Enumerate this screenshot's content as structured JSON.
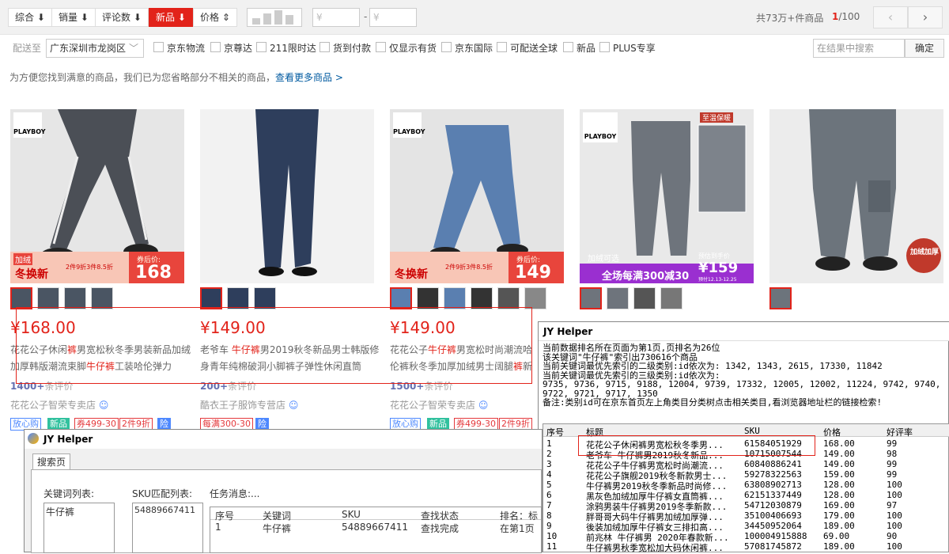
{
  "sortbar": {
    "items": [
      "综合",
      "销量",
      "评论数",
      "新品",
      "价格"
    ],
    "price_min_placeholder": "¥",
    "price_max_placeholder": "¥",
    "price_dash": "-",
    "total": "共73万+件商品",
    "page_current": "1",
    "page_total": "/100",
    "prev": "‹",
    "next": "›"
  },
  "filters": {
    "deliver_label": "配送至",
    "location": "广东深圳市龙岗区",
    "options": [
      "京东物流",
      "京尊达",
      "211限时达",
      "货到付款",
      "仅显示有货",
      "京东国际",
      "可配送全球",
      "新品",
      "PLUS专享"
    ],
    "search_placeholder": "在结果中搜索",
    "confirm": "确定"
  },
  "notice": {
    "text": "为方便您找到满意的商品，我们已为您省略部分不相关的商品，",
    "link": "查看更多商品 >"
  },
  "products": [
    {
      "price": "¥168.00",
      "title_a": "花花公子休闲",
      "title_b": "裤",
      "title_c": "男宽松秋冬季男装新品加绒加厚韩版潮流束脚",
      "title_d": "牛仔裤",
      "title_e": "工装哈伦弹力",
      "comments": "1400+",
      "comments_suffix": "条评价",
      "shop": "花花公子智荣专卖店",
      "badges": [
        "放心购",
        "新品",
        "券499-30",
        "2件9折",
        "险"
      ],
      "promo": "2件9折3件8.5折",
      "promo2": "券后价:",
      "promo_price": "168",
      "promo_tag": "冬换新",
      "brand": "PLAYBOY",
      "corner": "加绒"
    },
    {
      "price": "¥149.00",
      "title_a": "老爷车 ",
      "title_b": "牛仔裤",
      "title_c": "男2019秋冬新品男士韩版修身青年纯棉破洞小脚裤子弹性休闲直筒",
      "title_d": "",
      "title_e": "",
      "comments": "200+",
      "comments_suffix": "条评价",
      "shop": "酷衣王子服饰专营店",
      "badges": [
        "每满300-30",
        "险"
      ]
    },
    {
      "price": "¥149.00",
      "title_a": "花花公子",
      "title_b": "牛仔裤",
      "title_c": "男宽松时尚潮流哈伦裤秋冬季加厚加绒男士阔腿",
      "title_d": "裤",
      "title_e": "新品运",
      "comments": "1500+",
      "comments_suffix": "条评价",
      "shop": "花花公子智荣专卖店",
      "badges": [
        "放心购",
        "新品",
        "券499-30",
        "2件9折"
      ],
      "promo": "2件9折3件8.5折",
      "promo2": "券后价:",
      "promo_price": "149",
      "promo_tag": "冬换新",
      "brand": "PLAYBOY"
    },
    {
      "brand": "PLAYBOY",
      "banner": "全场每满300减30",
      "banner2": "预估到手价",
      "banner_price": "¥159",
      "banner_date": "预付12.13-12.25",
      "corner": "加绒可选",
      "top_tag": "至温保暖"
    },
    {
      "corner": "加绒加厚"
    }
  ],
  "helper_top": {
    "title": "JY Helper",
    "info": [
      "当前数据排名所在页面为第1页,页排名为26位",
      "该关键词\"牛仔裤\"索引出730616个商品",
      "当前关键词最优先索引的二级类别:id依次为: 1342, 1343, 2615, 17330, 11842",
      "当前关键词最优先索引的三级类别:id依次为:",
      "9735, 9736, 9715, 9188, 12004, 9739, 17332, 12005, 12002, 11224, 9742, 9740, 9722, 9721, 9717, 1350",
      "备注:类别id可在京东首页左上角类目分类树点击相关类目,看浏览器地址栏的链接检索!"
    ],
    "columns": [
      "序号",
      "标题",
      "SKU",
      "价格",
      "好评率"
    ],
    "rows": [
      [
        "1",
        "花花公子休闲裤男宽松秋冬季男...",
        "61584051929",
        "168.00",
        "99"
      ],
      [
        "2",
        "老爷车 牛仔裤男2019秋冬新品...",
        "10715007544",
        "149.00",
        "98"
      ],
      [
        "3",
        "花花公子牛仔裤男宽松时尚潮流...",
        "60840886241",
        "149.00",
        "99"
      ],
      [
        "4",
        "花花公子旗舰2019秋冬新款男士...",
        "59278322563",
        "159.00",
        "99"
      ],
      [
        "5",
        "牛仔裤男2019秋冬季新品时尚修...",
        "63808902713",
        "128.00",
        "100"
      ],
      [
        "6",
        "黑灰色加绒加厚牛仔裤女直筒裤...",
        "62151337449",
        "128.00",
        "100"
      ],
      [
        "7",
        "涂鸦男装牛仔裤男2019冬季新款...",
        "54712030879",
        "169.00",
        "97"
      ],
      [
        "8",
        "胖哥哥大码牛仔裤男加绒加厚弹...",
        "35100406693",
        "179.00",
        "100"
      ],
      [
        "9",
        "後装加绒加厚牛仔裤女三排扣高...",
        "34450952064",
        "189.00",
        "100"
      ],
      [
        "10",
        "前兆林 牛仔裤男 2020年春款新...",
        "100004915888",
        "69.00",
        "90"
      ],
      [
        "11",
        "牛仔裤男秋季宽松加大码休闲裤...",
        "57081745872",
        "189.00",
        "100"
      ]
    ]
  },
  "helper_main": {
    "title": "JY Helper",
    "tab": "搜索页",
    "kw_label": "关键词列表:",
    "sku_label": "SKU匹配列表:",
    "task_label": "任务消息:...",
    "kw_value": "牛仔裤",
    "sku_value": "54889667411",
    "columns": [
      "序号",
      "关键词",
      "SKU",
      "查找状态",
      "排名：标"
    ],
    "row": [
      "1",
      "牛仔裤",
      "54889667411",
      "查找完成",
      "在第1页"
    ]
  }
}
